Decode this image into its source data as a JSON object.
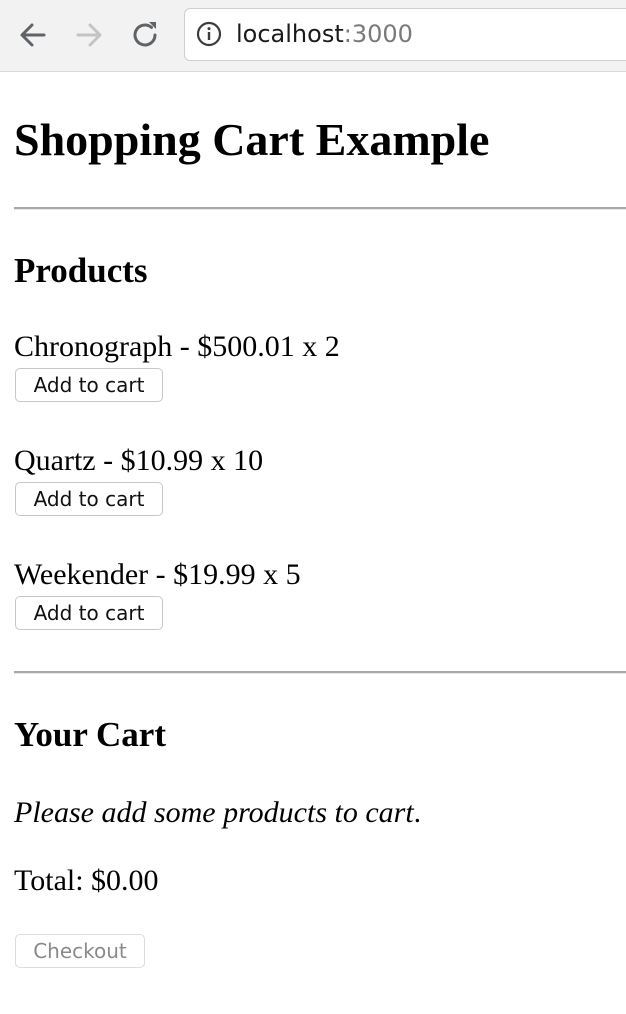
{
  "browser": {
    "url_host": "localhost",
    "url_port": ":3000",
    "icons": {
      "back": "arrow-left-icon",
      "forward": "arrow-right-icon",
      "reload": "reload-icon",
      "site_info": "info-icon"
    },
    "forward_enabled": false
  },
  "page": {
    "title": "Shopping Cart Example"
  },
  "products": {
    "heading": "Products",
    "items": [
      {
        "label": "Chronograph - $500.01 x 2",
        "button": "Add to cart"
      },
      {
        "label": "Quartz - $10.99 x 10",
        "button": "Add to cart"
      },
      {
        "label": "Weekender - $19.99 x 5",
        "button": "Add to cart"
      }
    ]
  },
  "cart": {
    "heading": "Your Cart",
    "empty_message": "Please add some products to cart",
    "empty_message_suffix": ".",
    "total": "Total: $0.00",
    "checkout_label": "Checkout",
    "checkout_enabled": false
  }
}
